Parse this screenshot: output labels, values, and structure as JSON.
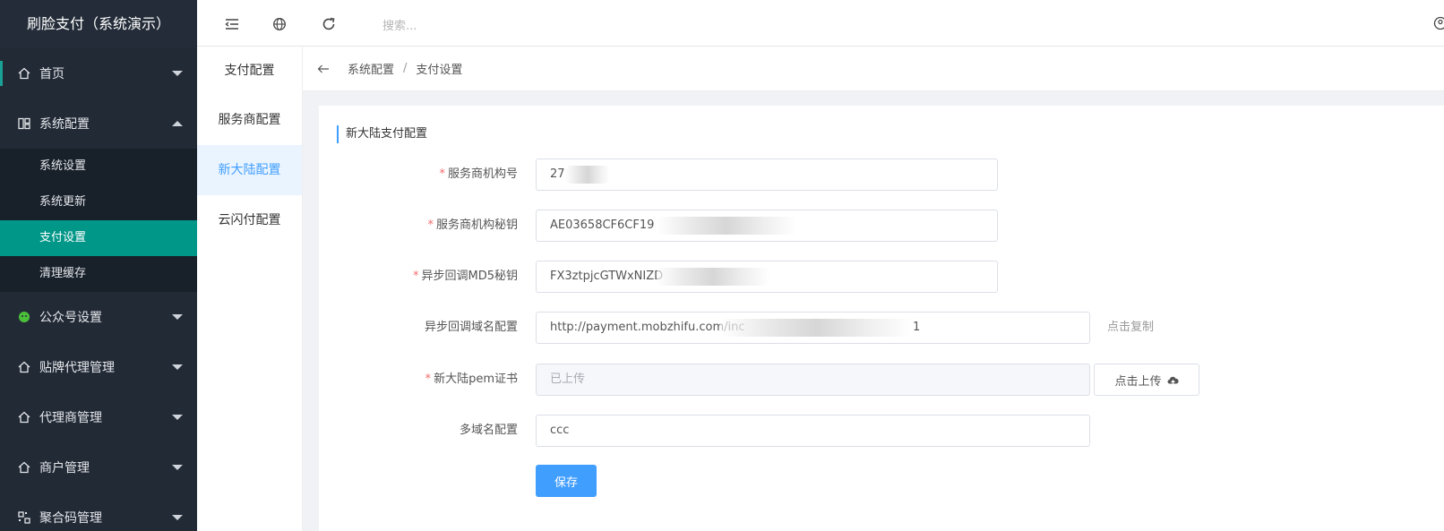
{
  "app": {
    "title": "刷脸支付（系统演示）"
  },
  "sidebar": {
    "items": [
      {
        "label": "首页",
        "icon": "home-icon"
      },
      {
        "label": "系统配置",
        "icon": "settings-grid-icon",
        "expanded": true,
        "children": [
          "系统设置",
          "系统更新",
          "支付设置",
          "清理缓存"
        ],
        "active_child": "支付设置"
      },
      {
        "label": "公众号设置",
        "icon": "wechat-icon"
      },
      {
        "label": "贴牌代理管理",
        "icon": "home-icon"
      },
      {
        "label": "代理商管理",
        "icon": "home-icon"
      },
      {
        "label": "商户管理",
        "icon": "home-icon"
      },
      {
        "label": "聚合码管理",
        "icon": "qrcode-icon"
      }
    ]
  },
  "topbar": {
    "search_placeholder": "搜索...",
    "icons": [
      "menu-fold-icon",
      "globe-icon",
      "refresh-icon"
    ]
  },
  "subnav": {
    "title": "支付配置",
    "items": [
      "服务商配置",
      "新大陆配置",
      "云闪付配置"
    ],
    "active": "新大陆配置"
  },
  "breadcrumb": {
    "items": [
      "系统配置",
      "支付设置"
    ],
    "separator": "/"
  },
  "form": {
    "section_title": "新大陆支付配置",
    "fields": [
      {
        "label": "服务商机构号",
        "required": true,
        "value": "27"
      },
      {
        "label": "服务商机构秘钥",
        "required": true,
        "value": "AE03658CF6CF19"
      },
      {
        "label": "异步回调MD5秘钥",
        "required": true,
        "value": "FX3ztpjcGTWxNIZD"
      },
      {
        "label": "异步回调域名配置",
        "required": false,
        "value": "http://payment.mobzhifu.com/inc",
        "value_tail": "1",
        "action": "点击复制"
      },
      {
        "label": "新大陆pem证书",
        "required": true,
        "value": "已上传",
        "disabled": true,
        "action": "点击上传"
      },
      {
        "label": "多域名配置",
        "required": false,
        "value": "ccc"
      }
    ],
    "submit_label": "保存"
  },
  "colors": {
    "sidebar_bg": "#222a36",
    "active_green": "#009688",
    "primary_blue": "#409eff",
    "required_red": "#f56c6c"
  }
}
